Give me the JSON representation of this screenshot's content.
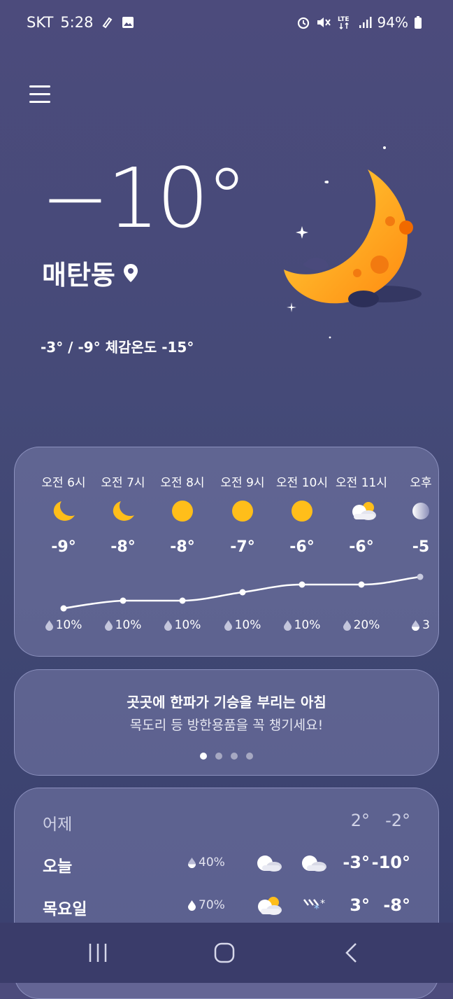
{
  "status_bar": {
    "carrier": "SKT",
    "time": "5:28",
    "battery": "94%",
    "icons": [
      "notepad-icon",
      "image-icon",
      "alarm-icon",
      "mute-icon",
      "lte-icon",
      "signal-icon",
      "battery-icon"
    ]
  },
  "current": {
    "temperature": "−10°",
    "location": "매탄동",
    "minmax_feels": "-3° / -9° 체감온도 -15°"
  },
  "hourly": [
    {
      "time": "오전 6시",
      "icon": "moon-icon",
      "temp": "-9°",
      "pop": "10%"
    },
    {
      "time": "오전 7시",
      "icon": "moon-icon",
      "temp": "-8°",
      "pop": "10%"
    },
    {
      "time": "오전 8시",
      "icon": "sun-icon",
      "temp": "-8°",
      "pop": "10%"
    },
    {
      "time": "오전 9시",
      "icon": "sun-icon",
      "temp": "-7°",
      "pop": "10%"
    },
    {
      "time": "오전 10시",
      "icon": "sun-icon",
      "temp": "-6°",
      "pop": "10%"
    },
    {
      "time": "오전 11시",
      "icon": "partly-cloudy-icon",
      "temp": "-6°",
      "pop": "20%"
    },
    {
      "time": "오후",
      "icon": "cloud-icon",
      "temp": "-5",
      "pop": "3"
    }
  ],
  "tip": {
    "title": "곳곳에 한파가 기승을 부리는 아침",
    "subtitle": "목도리 등 방한용품을 꼭 챙기세요!"
  },
  "daily": [
    {
      "day": "어제",
      "pop": "",
      "hi": "2°",
      "lo": "-2°"
    },
    {
      "day": "오늘",
      "pop": "40%",
      "hi": "-3°",
      "lo": "-10°"
    },
    {
      "day": "목요일",
      "pop": "70%",
      "hi": "3°",
      "lo": "-8°"
    }
  ],
  "colors": {
    "accent": "#ffbe1a",
    "background": "#46497a"
  }
}
